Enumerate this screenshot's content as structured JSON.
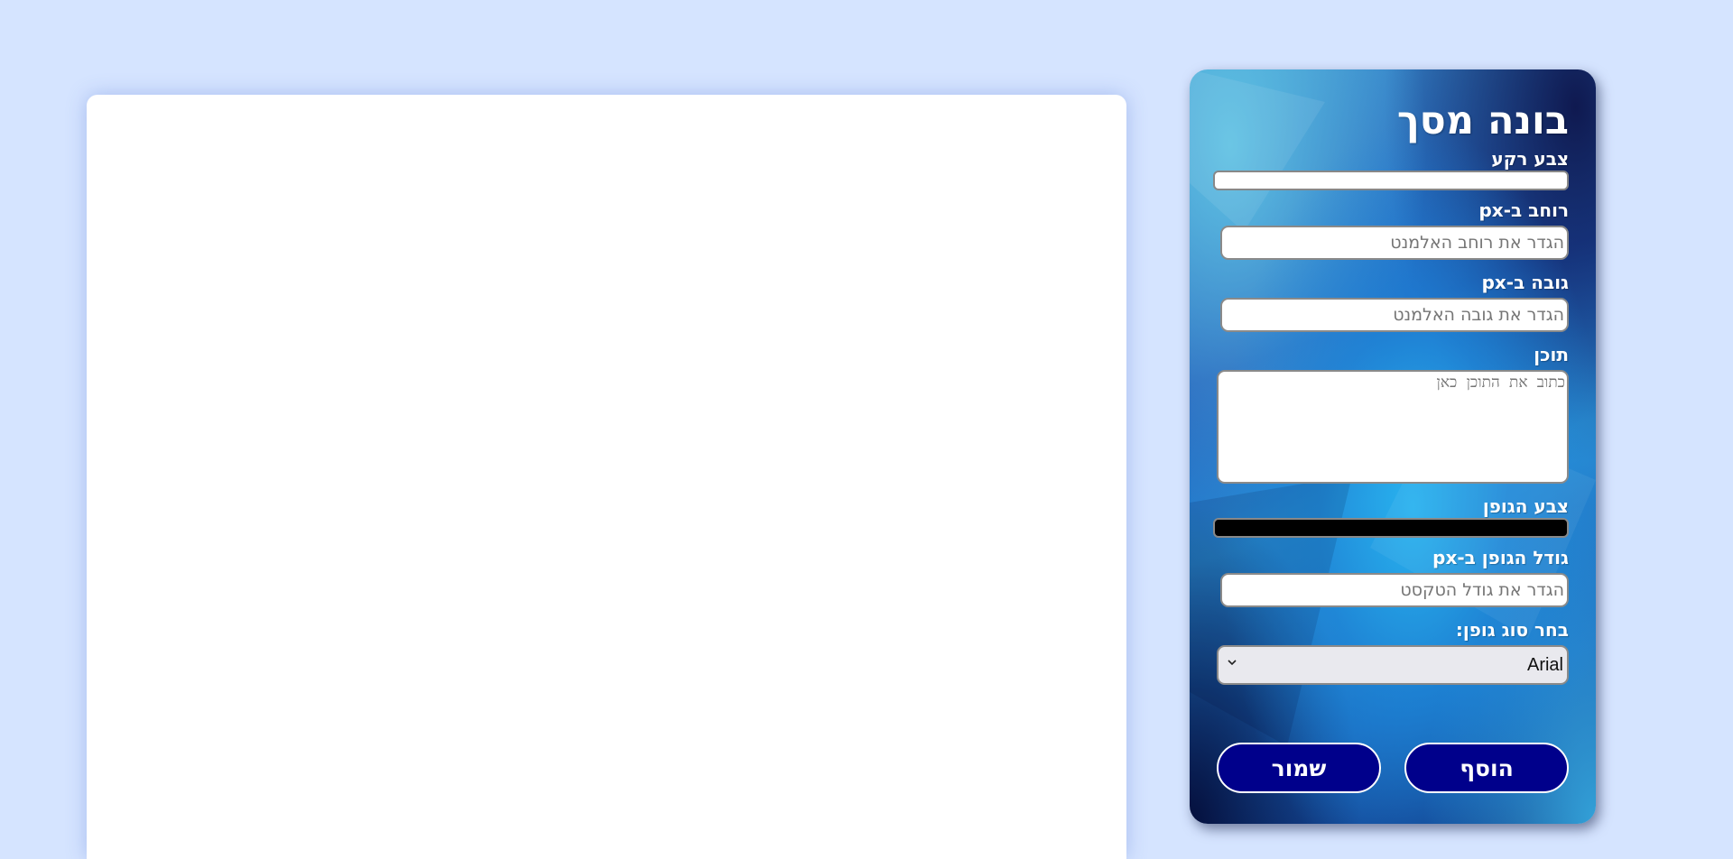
{
  "canvas": {
    "background": "#ffffff"
  },
  "panel": {
    "title": "בונה מסך",
    "fields": {
      "bg_color": {
        "label": "צבע רקע",
        "value": "#ffffff"
      },
      "width": {
        "label": "רוחב ב-px",
        "placeholder": "הגדר את רוחב האלמנט",
        "value": ""
      },
      "height": {
        "label": "גובה ב-px",
        "placeholder": "הגדר את גובה האלמנט",
        "value": ""
      },
      "content": {
        "label": "תוכן",
        "placeholder": "כתוב את התוכן כאן",
        "value": ""
      },
      "font_color": {
        "label": "צבע הגופן",
        "value": "#000000"
      },
      "font_size": {
        "label": "גודל הגופן ב-px",
        "placeholder": "הגדר את גודל הטקסט",
        "value": ""
      },
      "font_family": {
        "label": "בחר סוג גופן:",
        "selected": "Arial"
      }
    },
    "buttons": {
      "add": "הוסף",
      "save": "שמור"
    }
  },
  "colors": {
    "page_background": "#d5e4ff",
    "button_background": "#00008b"
  }
}
